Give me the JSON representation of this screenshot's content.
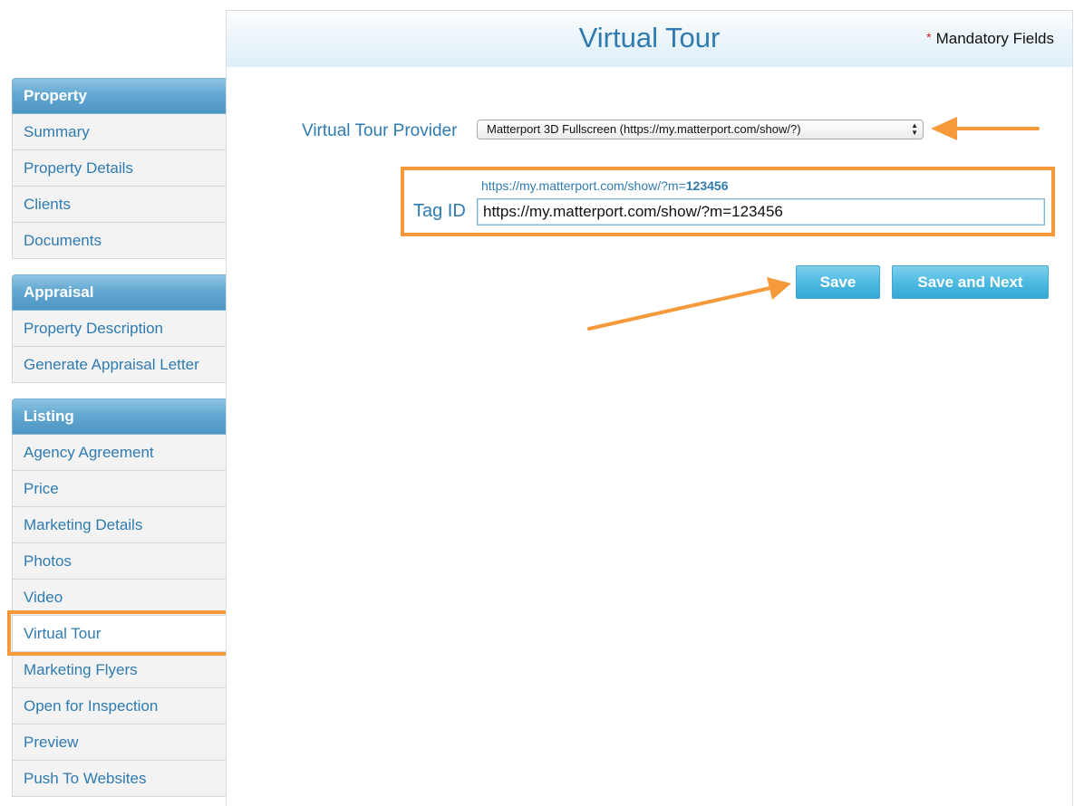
{
  "sidebar": {
    "groups": [
      {
        "title": "Property",
        "items": [
          "Summary",
          "Property Details",
          "Clients",
          "Documents"
        ]
      },
      {
        "title": "Appraisal",
        "items": [
          "Property Description",
          "Generate Appraisal Letter"
        ]
      },
      {
        "title": "Listing",
        "items": [
          "Agency Agreement",
          "Price",
          "Marketing Details",
          "Photos",
          "Video",
          "Virtual Tour",
          "Marketing Flyers",
          "Open for Inspection",
          "Preview",
          "Push To Websites"
        ]
      }
    ],
    "active_item": "Virtual Tour"
  },
  "main": {
    "title": "Virtual Tour",
    "mandatory_star": "*",
    "mandatory_label": "Mandatory Fields",
    "provider_label": "Virtual Tour Provider",
    "provider_value": "Matterport 3D Fullscreen (https://my.matterport.com/show/?)",
    "tag_hint_prefix": "https://my.matterport.com/show/?m=",
    "tag_hint_id": "123456",
    "tag_label": "Tag ID",
    "tag_value": "https://my.matterport.com/show/?m=123456",
    "save_label": "Save",
    "save_next_label": "Save and Next"
  },
  "colors": {
    "accent": "#2f7bb0",
    "highlight": "#f5993a",
    "button": "#4ab8e0"
  }
}
